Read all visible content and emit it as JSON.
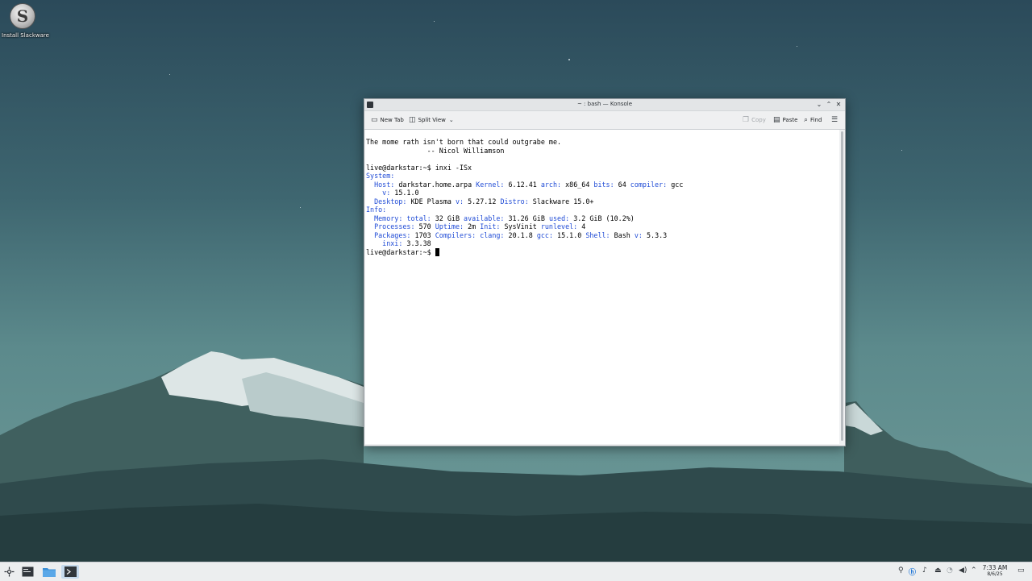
{
  "desktop": {
    "icon_label": "Install Slackware",
    "icon_glyph": "S"
  },
  "window": {
    "title": "~ : bash — Konsole",
    "controls": {
      "minimize": "⌄",
      "maximize": "⌃",
      "close": "✕"
    }
  },
  "toolbar": {
    "new_tab": "New Tab",
    "split_view": "Split View",
    "copy": "Copy",
    "paste": "Paste",
    "find": "Find"
  },
  "terminal": {
    "lines": [
      [
        {
          "t": "The mome rath isn't born that could outgrabe me."
        }
      ],
      [
        {
          "t": "               -- Nicol Williamson"
        }
      ],
      [
        {
          "t": " "
        }
      ],
      [
        {
          "t": "live@darkstar:~$ inxi -ISx"
        }
      ],
      [
        {
          "t": "System:",
          "c": "k"
        }
      ],
      [
        {
          "t": "  "
        },
        {
          "t": "Host:",
          "c": "k"
        },
        {
          "t": " darkstar.home.arpa "
        },
        {
          "t": "Kernel:",
          "c": "k"
        },
        {
          "t": " 6.12.41 "
        },
        {
          "t": "arch:",
          "c": "k"
        },
        {
          "t": " x86_64 "
        },
        {
          "t": "bits:",
          "c": "k"
        },
        {
          "t": " 64 "
        },
        {
          "t": "compiler:",
          "c": "k"
        },
        {
          "t": " gcc"
        }
      ],
      [
        {
          "t": "    "
        },
        {
          "t": "v:",
          "c": "k"
        },
        {
          "t": " 15.1.0"
        }
      ],
      [
        {
          "t": "  "
        },
        {
          "t": "Desktop:",
          "c": "k"
        },
        {
          "t": " KDE Plasma "
        },
        {
          "t": "v:",
          "c": "k"
        },
        {
          "t": " 5.27.12 "
        },
        {
          "t": "Distro:",
          "c": "k"
        },
        {
          "t": " Slackware 15.0+"
        }
      ],
      [
        {
          "t": "Info:",
          "c": "k"
        }
      ],
      [
        {
          "t": "  "
        },
        {
          "t": "Memory:",
          "c": "k"
        },
        {
          "t": " "
        },
        {
          "t": "total:",
          "c": "k"
        },
        {
          "t": " 32 GiB "
        },
        {
          "t": "available:",
          "c": "k"
        },
        {
          "t": " 31.26 GiB "
        },
        {
          "t": "used:",
          "c": "k"
        },
        {
          "t": " 3.2 GiB (10.2%)"
        }
      ],
      [
        {
          "t": "  "
        },
        {
          "t": "Processes:",
          "c": "k"
        },
        {
          "t": " 570 "
        },
        {
          "t": "Uptime:",
          "c": "k"
        },
        {
          "t": " 2m "
        },
        {
          "t": "Init:",
          "c": "k"
        },
        {
          "t": " SysVinit "
        },
        {
          "t": "runlevel:",
          "c": "k"
        },
        {
          "t": " 4"
        }
      ],
      [
        {
          "t": "  "
        },
        {
          "t": "Packages:",
          "c": "k"
        },
        {
          "t": " 1703 "
        },
        {
          "t": "Compilers:",
          "c": "k"
        },
        {
          "t": " "
        },
        {
          "t": "clang:",
          "c": "k"
        },
        {
          "t": " 20.1.8 "
        },
        {
          "t": "gcc:",
          "c": "k"
        },
        {
          "t": " 15.1.0 "
        },
        {
          "t": "Shell:",
          "c": "k"
        },
        {
          "t": " Bash "
        },
        {
          "t": "v:",
          "c": "k"
        },
        {
          "t": " 5.3.3"
        }
      ],
      [
        {
          "t": "    "
        },
        {
          "t": "inxi:",
          "c": "k"
        },
        {
          "t": " 3.3.38"
        }
      ]
    ],
    "prompt": "live@darkstar:~$ "
  },
  "taskbar": {
    "clock_time": "7:33 AM",
    "clock_date": "8/6/25"
  },
  "colors": {
    "keyword": "#1f4bd6",
    "terminal_bg": "#ffffff"
  },
  "icons": {
    "launcher": "application-launcher-icon",
    "new_tab": "new-tab-icon",
    "split_view": "split-view-icon",
    "copy": "copy-icon",
    "paste": "paste-icon",
    "find": "search-icon",
    "menu": "hamburger-menu-icon"
  }
}
